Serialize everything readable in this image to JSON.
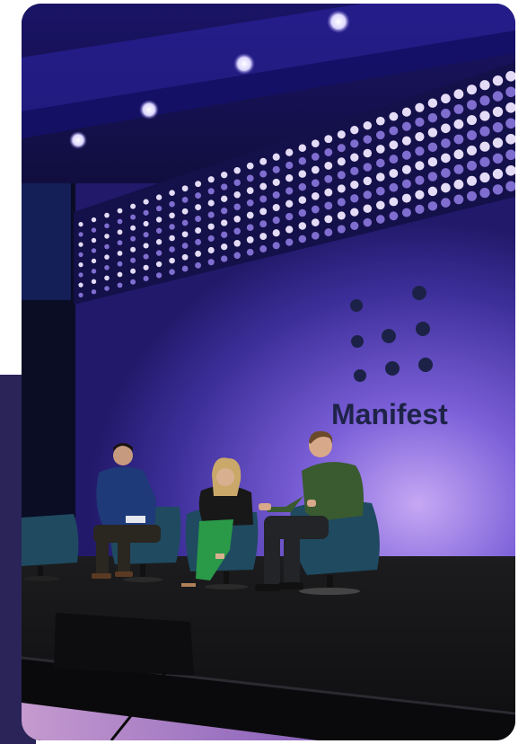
{
  "photo": {
    "description_label": "panel-discussion-stage",
    "logo_text": "Manifest",
    "colors": {
      "stage_wall": "#4a3aa8",
      "wall_glow": "#b89cf0",
      "led_light": "#efe8ff",
      "floor": "#151515",
      "chair": "#1f4a60",
      "accent_panel": "#2a2458"
    }
  }
}
